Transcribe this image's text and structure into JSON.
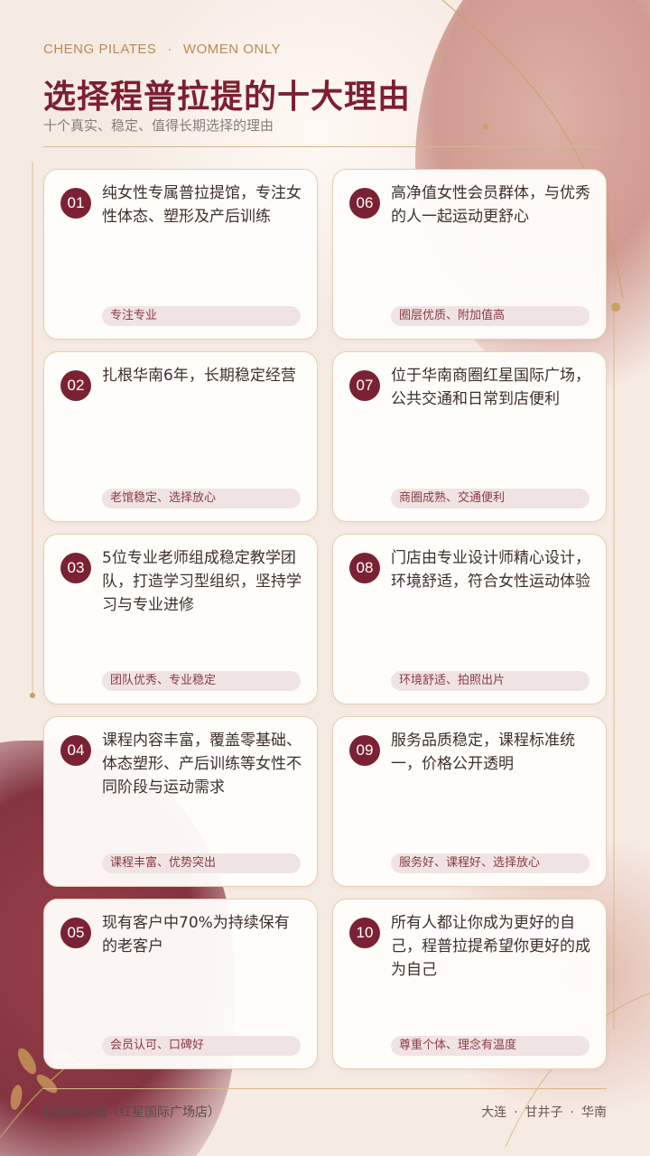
{
  "header": {
    "brand": "CHENG PILATES",
    "separator": "·",
    "tagline": "WOMEN ONLY",
    "title": "选择程普拉提的十大理由",
    "subtitle": "十个真实、稳定、值得长期选择的理由"
  },
  "reasons": [
    {
      "number": "01",
      "text": "纯女性专属普拉提馆，专注女性体态、塑形及产后训练",
      "tag": "专注专业"
    },
    {
      "number": "02",
      "text": "扎根华南6年，长期稳定经营",
      "tag": "老馆稳定、选择放心"
    },
    {
      "number": "03",
      "text": "5位专业老师组成稳定教学团队，打造学习型组织，坚持学习与专业进修",
      "tag": "团队优秀、专业稳定"
    },
    {
      "number": "04",
      "text": "课程内容丰富，覆盖零基础、体态塑形、产后训练等女性不同阶段与运动需求",
      "tag": "课程丰富、优势突出"
    },
    {
      "number": "05",
      "text": "现有客户中70%为持续保有的老客户",
      "tag": "会员认可、口碑好"
    },
    {
      "number": "06",
      "text": "高净值女性会员群体，与优秀的人一起运动更舒心",
      "tag": "圈层优质、附加值高"
    },
    {
      "number": "07",
      "text": "位于华南商圈红星国际广场，公共交通和日常到店便利",
      "tag": "商圈成熟、交通便利"
    },
    {
      "number": "08",
      "text": "门店由专业设计师精心设计，环境舒适，符合女性运动体验",
      "tag": "环境舒适、拍照出片"
    },
    {
      "number": "09",
      "text": "服务品质稳定，课程标准统一，价格公开透明",
      "tag": "服务好、课程好、选择放心"
    },
    {
      "number": "10",
      "text": "所有人都让你成为更好的自己，程普拉提希望你更好的成为自己",
      "tag": "尊重个体、理念有温度"
    }
  ],
  "footer": {
    "store": "程普拉提馆（红星国际广场店）",
    "city": "大连",
    "district": "甘井子",
    "area": "华南",
    "separator": "·"
  },
  "colors": {
    "accent": "#7a2233",
    "gold": "#c9a063",
    "background": "#f6ebe3",
    "tag_bg": "#f0e3e3"
  }
}
